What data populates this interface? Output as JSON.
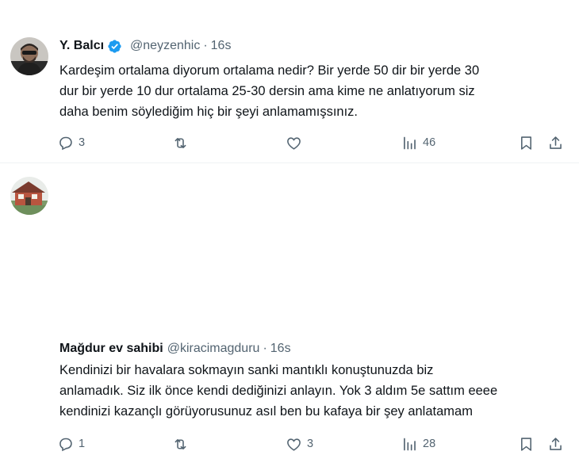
{
  "tweets": [
    {
      "author": {
        "name": "Y. Balcı",
        "handle": "@neyzenhic",
        "verified": true
      },
      "separator": "·",
      "time": "16s",
      "text_lines": [
        "Kardeşim ortalama diyorum ortalama nedir? Bir yerde 50 dir bir yerde 30",
        "dur bir yerde 10 dur ortalama 25-30 dersin ama kime ne anlatıyorum siz",
        "daha benim söylediğim hiç bir şeyi anlamamışsınız."
      ],
      "actions": {
        "replies": "3",
        "retweets": "",
        "likes": "",
        "views": "46"
      }
    },
    {
      "author": {
        "name": "Mağdur ev sahibi",
        "handle": "@kiracimagduru",
        "verified": false
      },
      "separator": "·",
      "time": "16s",
      "text_lines": [
        "Kendinizi bir havalara sokmayın sanki mantıklı konuştunuzda biz",
        "anlamadık. Siz ilk önce kendi dediğinizi anlayın. Yok 3 aldım 5e sattım eeee",
        "kendinizi kazançlı görüyorusunuz asıl ben bu kafaya bir şey anlatamam"
      ],
      "actions": {
        "replies": "1",
        "retweets": "",
        "likes": "3",
        "views": "28"
      }
    }
  ],
  "colors": {
    "text": "#0f1419",
    "secondary": "#536471",
    "verified": "#1d9bf0",
    "divider": "#eff3f4"
  },
  "icons": [
    "reply-icon",
    "retweet-icon",
    "like-icon",
    "views-icon",
    "bookmark-icon",
    "share-icon",
    "verified-badge-icon"
  ]
}
